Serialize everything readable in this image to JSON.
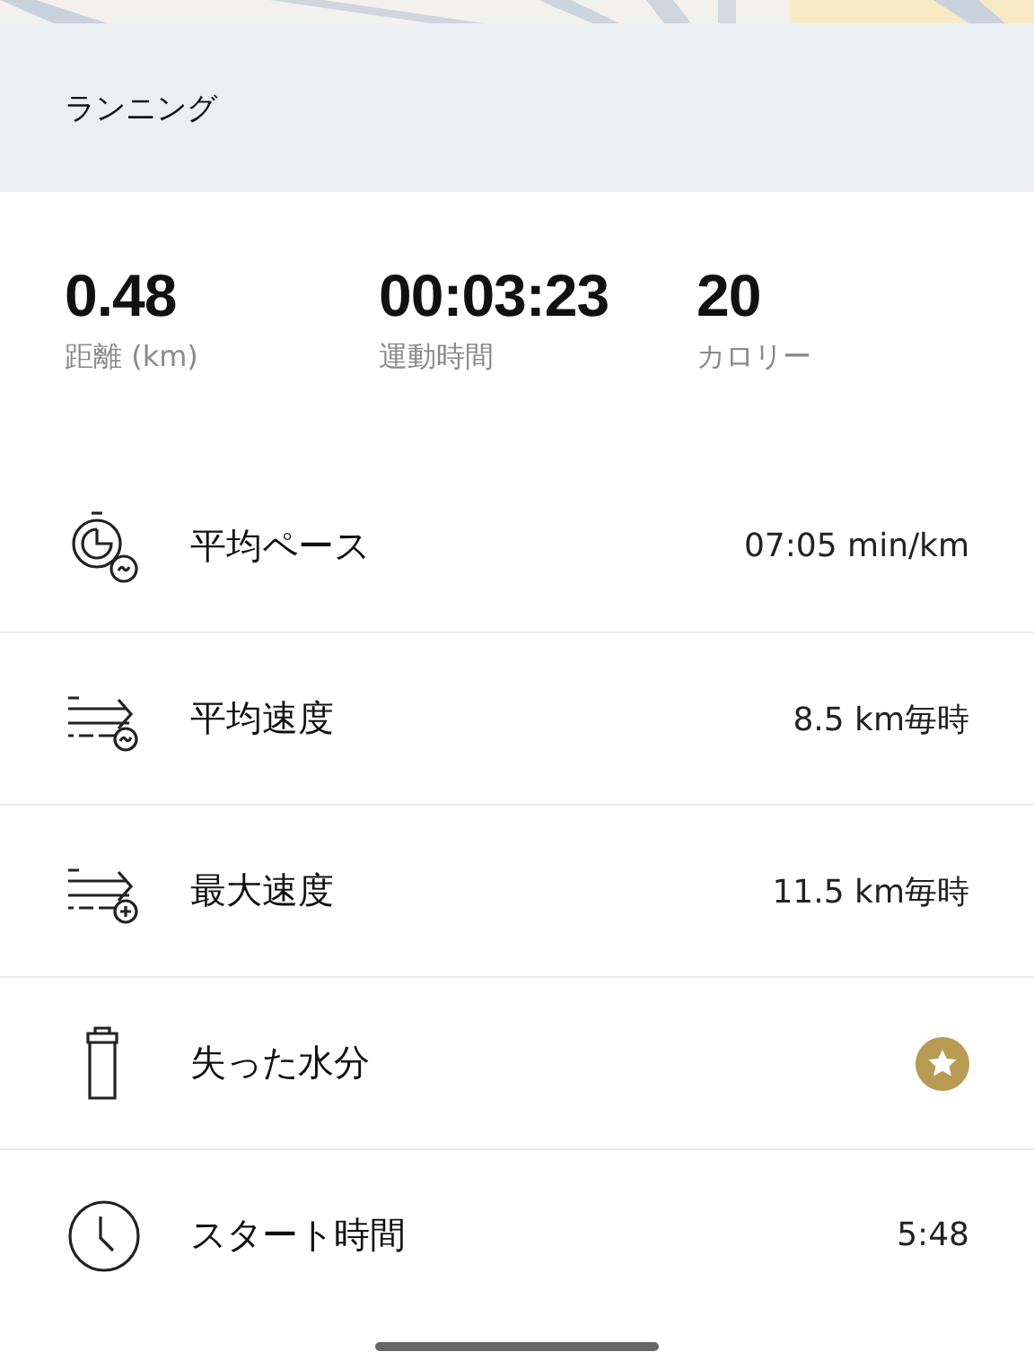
{
  "header": {
    "title": "ランニング"
  },
  "stats": [
    {
      "value": "0.48",
      "label": "距離 (km)"
    },
    {
      "value": "00:03:23",
      "label": "運動時間"
    },
    {
      "value": "20",
      "label": "カロリー"
    }
  ],
  "rows": [
    {
      "kind": "pace",
      "label": "平均ペース",
      "value": "07:05 min/km",
      "locked": false
    },
    {
      "kind": "avg_speed",
      "label": "平均速度",
      "value": "8.5 km毎時",
      "locked": false
    },
    {
      "kind": "max_speed",
      "label": "最大速度",
      "value": "11.5 km毎時",
      "locked": false
    },
    {
      "kind": "water",
      "label": "失った水分",
      "locked": true
    },
    {
      "kind": "clock",
      "label": "スタート時間",
      "value": "5:48",
      "locked": false
    }
  ]
}
